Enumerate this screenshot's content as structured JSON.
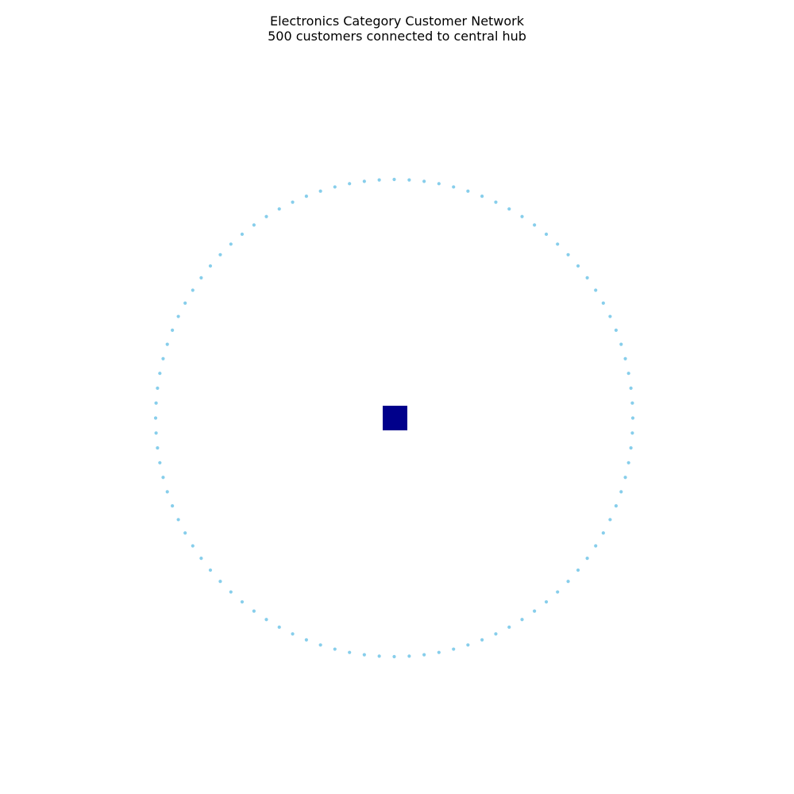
{
  "title": "Electronics Category Customer Network",
  "subtitle": "500 customers connected to central hub",
  "network": {
    "hub_count": 1,
    "customer_count": 500,
    "visible_customer_markers": 100,
    "hub_color": "#00008b",
    "customer_color": "#87ceeb",
    "hub_shape": "square",
    "customer_shape": "dot"
  }
}
